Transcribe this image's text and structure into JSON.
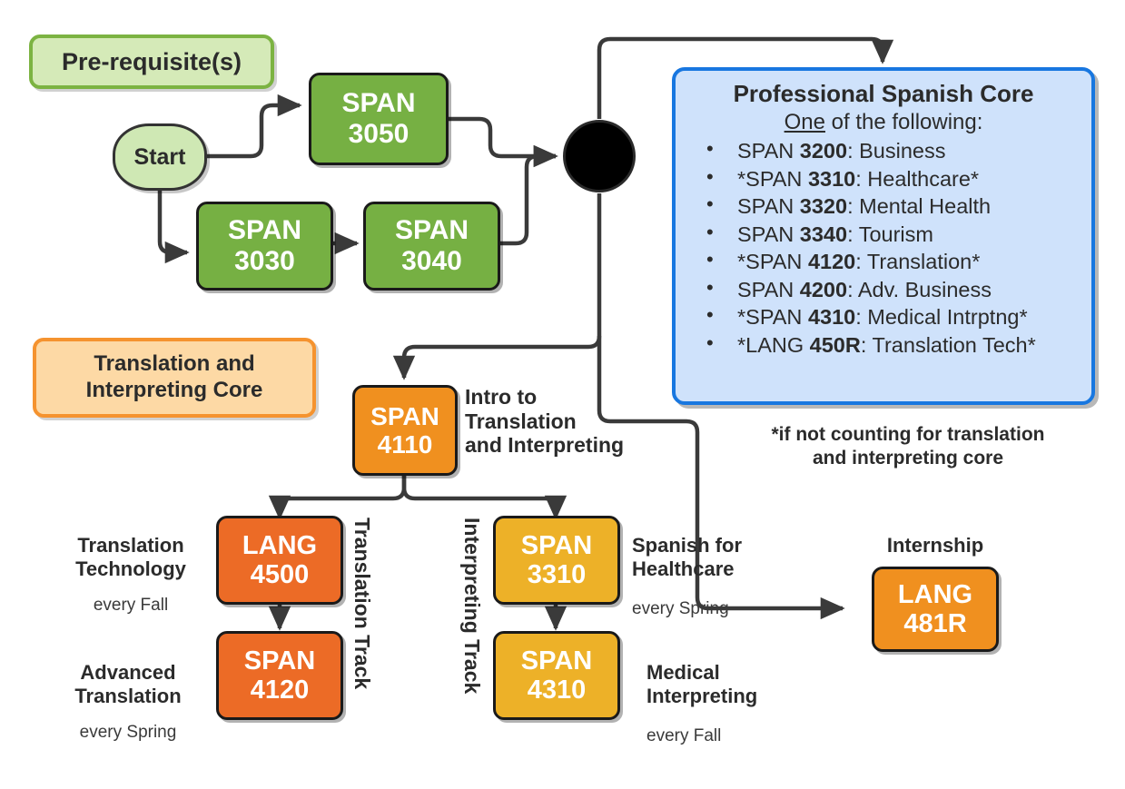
{
  "colors": {
    "green_node": "#76b043",
    "green_legend_fill": "#d5eab8",
    "green_legend_border": "#7cb342",
    "start_fill": "#cfe8b4",
    "orange_legend_fill": "#fdd9a5",
    "orange_legend_border": "#f5932f",
    "orange_node": "#f0901f",
    "orange_red_node": "#ec6b26",
    "yellow_node": "#edb128",
    "core_fill": "#cfe2fb",
    "core_border": "#1877e0",
    "line": "#3a3a3a",
    "node_border": "#1a1a1a",
    "text_dark": "#2b2b2b"
  },
  "legends": {
    "prerequisite": "Pre-requisite(s)",
    "translation_core_line1": "Translation and",
    "translation_core_line2": "Interpreting Core"
  },
  "start": {
    "label": "Start"
  },
  "prereq_nodes": [
    {
      "id": "span3050",
      "line1": "SPAN",
      "line2": "3050"
    },
    {
      "id": "span3030",
      "line1": "SPAN",
      "line2": "3030"
    },
    {
      "id": "span3040",
      "line1": "SPAN",
      "line2": "3040"
    }
  ],
  "core_box": {
    "title": "Professional Spanish Core",
    "subtitle_underlined": "One",
    "subtitle_rest": " of the following:",
    "items": [
      {
        "prefix": "SPAN ",
        "code": "3200",
        "suffix": ": Business"
      },
      {
        "prefix": "*SPAN ",
        "code": "3310",
        "suffix": ": Healthcare*"
      },
      {
        "prefix": "SPAN ",
        "code": "3320",
        "suffix": ": Mental Health"
      },
      {
        "prefix": "SPAN ",
        "code": "3340",
        "suffix": ": Tourism"
      },
      {
        "prefix": "*SPAN ",
        "code": "4120",
        "suffix": ": Translation*"
      },
      {
        "prefix": "SPAN ",
        "code": "4200",
        "suffix": ": Adv. Business"
      },
      {
        "prefix": "*SPAN ",
        "code": "4310",
        "suffix": ": Medical Intrptng*"
      },
      {
        "prefix": "*LANG ",
        "code": "450R",
        "suffix": ": Translation Tech*"
      }
    ]
  },
  "footnote": {
    "line1": "*if not counting for translation",
    "line2": "and interpreting core"
  },
  "core_intro": {
    "node_line1": "SPAN",
    "node_line2": "4110",
    "label_line1": "Intro to",
    "label_line2": "Translation",
    "label_line3": "and Interpreting"
  },
  "tracks": {
    "translation_track_label": "Translation Track",
    "interpreting_track_label": "Interpreting Track"
  },
  "track_courses": [
    {
      "id": "lang4500",
      "line1": "LANG",
      "line2": "4500",
      "title_line1": "Translation",
      "title_line2": "Technology",
      "term": "every Fall"
    },
    {
      "id": "span4120",
      "line1": "SPAN",
      "line2": "4120",
      "title_line1": "Advanced",
      "title_line2": "Translation",
      "term": "every Spring"
    },
    {
      "id": "span3310",
      "line1": "SPAN",
      "line2": "3310",
      "title_line1": "Spanish for",
      "title_line2": "Healthcare",
      "term": "every Spring"
    },
    {
      "id": "span4310",
      "line1": "SPAN",
      "line2": "4310",
      "title_line1": "Medical",
      "title_line2": "Interpreting",
      "term": "every Fall"
    }
  ],
  "internship": {
    "label": "Internship",
    "node_line1": "LANG",
    "node_line2": "481R"
  }
}
